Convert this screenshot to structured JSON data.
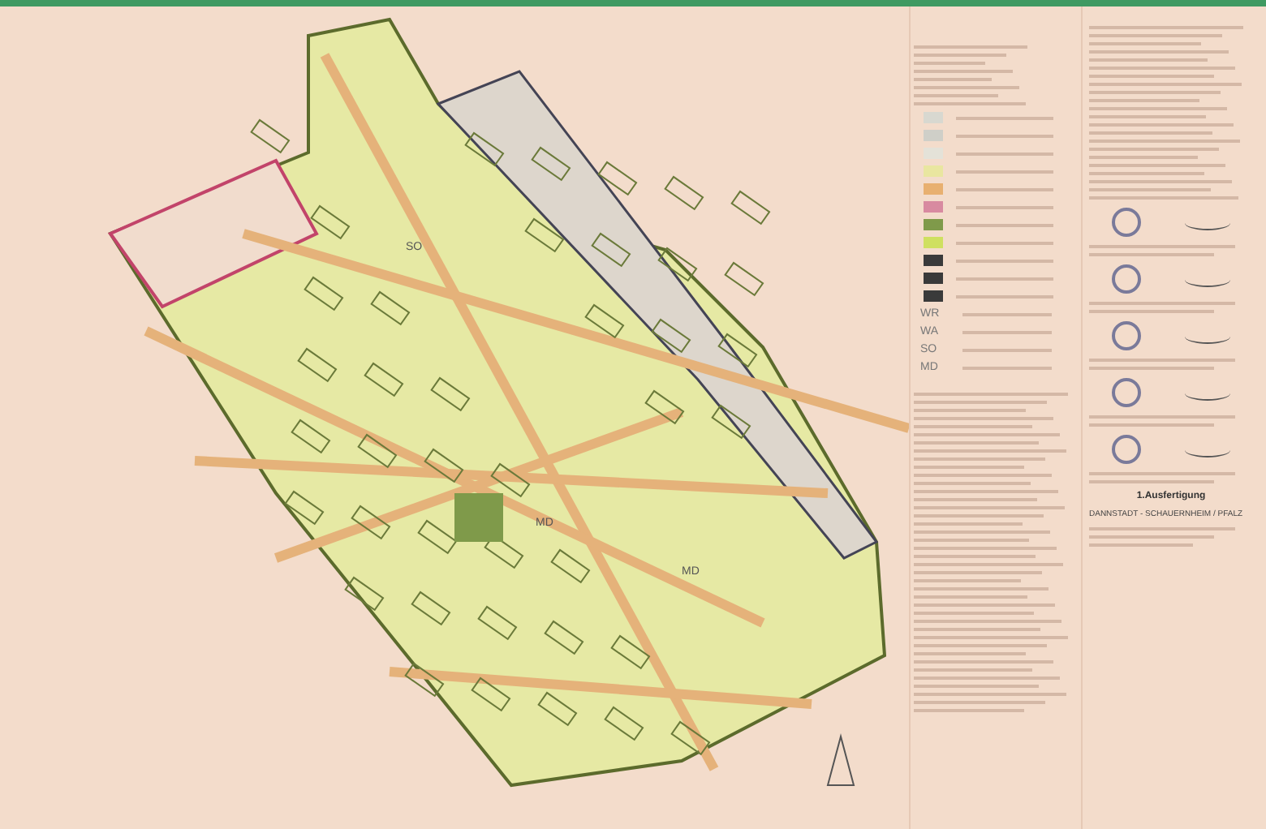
{
  "map": {
    "labels": [
      {
        "text": "SO"
      },
      {
        "text": "MD"
      },
      {
        "text": "MD"
      }
    ]
  },
  "legend": {
    "swatches": [
      {
        "color": "#d8d8d0"
      },
      {
        "color": "#cfcfc8"
      },
      {
        "color": "#e4e2d8"
      },
      {
        "color": "#e9e6a0"
      },
      {
        "color": "#e8b070"
      },
      {
        "color": "#d88aa0"
      },
      {
        "color": "#7f9a4a"
      },
      {
        "color": "#cfe060"
      },
      {
        "color": "#3a3a3a"
      },
      {
        "color": "#3a3a3a"
      },
      {
        "color": "#3a3a3a"
      }
    ],
    "codes": [
      "WR",
      "WA",
      "SO",
      "MD"
    ]
  },
  "certification": {
    "stamps": [
      {
        "kind": "seal"
      },
      {
        "kind": "seal"
      },
      {
        "kind": "seal"
      },
      {
        "kind": "seal"
      },
      {
        "kind": "seal"
      }
    ],
    "heading": "1.Ausfertigung",
    "place": "DANNSTADT - SCHAUERNHEIM / PFALZ"
  }
}
